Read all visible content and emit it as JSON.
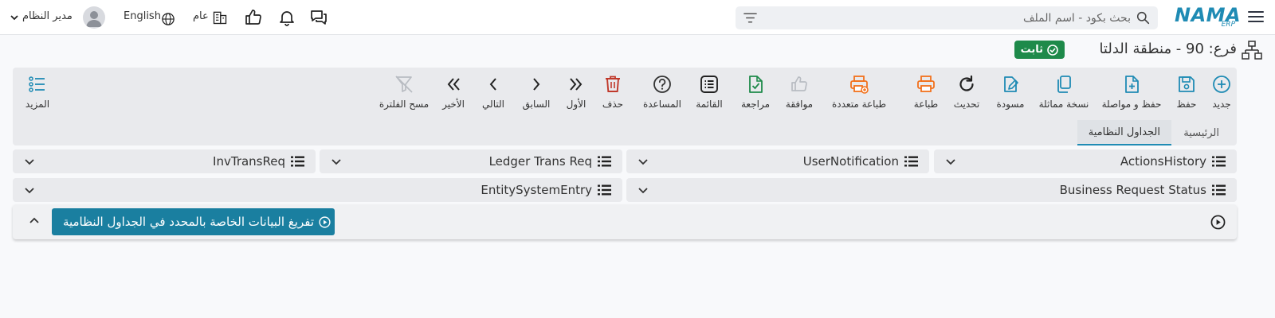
{
  "header": {
    "logo": {
      "main": "NAMA",
      "sub": "ERP"
    },
    "search": {
      "placeholder": "بحث بكود - اسم الملف",
      "icon": "search-icon"
    },
    "language_label": "English",
    "public_label": "عام",
    "user_name": "مدير النظام",
    "icons": [
      "menu-icon",
      "filter-icon",
      "chat-icon",
      "bell-icon",
      "thumbs-up-icon",
      "building-icon",
      "globe-icon",
      "avatar-icon",
      "chevron-down-icon"
    ]
  },
  "page": {
    "title": "فرع: 90 - منطقة الدلتا",
    "status_badge": "ثابت"
  },
  "toolbar": {
    "buttons": [
      {
        "label": "جديد",
        "icon": "plus-circle-icon",
        "color": "#1f8bb4"
      },
      {
        "label": "حفظ",
        "icon": "save-icon",
        "color": "#1f8bb4"
      },
      {
        "label": "حفظ و مواصلة",
        "icon": "file-plus-icon",
        "color": "#1f8bb4"
      },
      {
        "label": "نسخة مماثلة",
        "icon": "copy-icon",
        "color": "#1f8bb4"
      },
      {
        "label": "مسودة",
        "icon": "edit-icon",
        "color": "#1f8bb4"
      },
      {
        "label": "تحديث",
        "icon": "refresh-icon",
        "color": "#222222"
      },
      {
        "label": "طباعة",
        "icon": "printer-icon",
        "color": "#f2711c"
      },
      {
        "label": "طباعة متعددة",
        "icon": "multi-printer-icon",
        "color": "#f2711c"
      },
      {
        "label": "موافقة",
        "icon": "thumbs-up-icon",
        "color": "#b8bcc2"
      },
      {
        "label": "مراجعة",
        "icon": "file-check-icon",
        "color": "#1e8a4a"
      },
      {
        "label": "القائمة",
        "icon": "list-icon",
        "color": "#222222"
      },
      {
        "label": "المساعدة",
        "icon": "help-icon",
        "color": "#333333"
      },
      {
        "label": "حذف",
        "icon": "trash-icon",
        "color": "#c0392b"
      },
      {
        "label": "الأول",
        "icon": "double-chevron-right-icon",
        "color": "#222222"
      },
      {
        "label": "السابق",
        "icon": "chevron-right-icon",
        "color": "#222222"
      },
      {
        "label": "التالي",
        "icon": "chevron-left-icon",
        "color": "#222222"
      },
      {
        "label": "الأخير",
        "icon": "double-chevron-left-icon",
        "color": "#222222"
      },
      {
        "label": "مسح الفلترة",
        "icon": "filter-clear-icon",
        "color": "#b8bcc2"
      }
    ],
    "more_label": "المزيد"
  },
  "tabs": [
    {
      "label": "الرئيسية",
      "active": false
    },
    {
      "label": "الجداول النظامية",
      "active": true
    }
  ],
  "panels": [
    {
      "title": "ActionsHistory"
    },
    {
      "title": "UserNotification"
    },
    {
      "title": "Ledger Trans Req"
    },
    {
      "title": "InvTransReq"
    },
    {
      "title": "Business Request Status"
    },
    {
      "title": "EntitySystemEntry"
    }
  ],
  "bottom_panel": {
    "button_label": "تفريغ البيانات الخاصة بالمحدد في الجداول النظامية"
  },
  "colors": {
    "brand": "#1f8bb4",
    "success": "#1e8a4a",
    "action_button": "#1a7fa0",
    "print": "#f2711c",
    "delete": "#c0392b"
  }
}
